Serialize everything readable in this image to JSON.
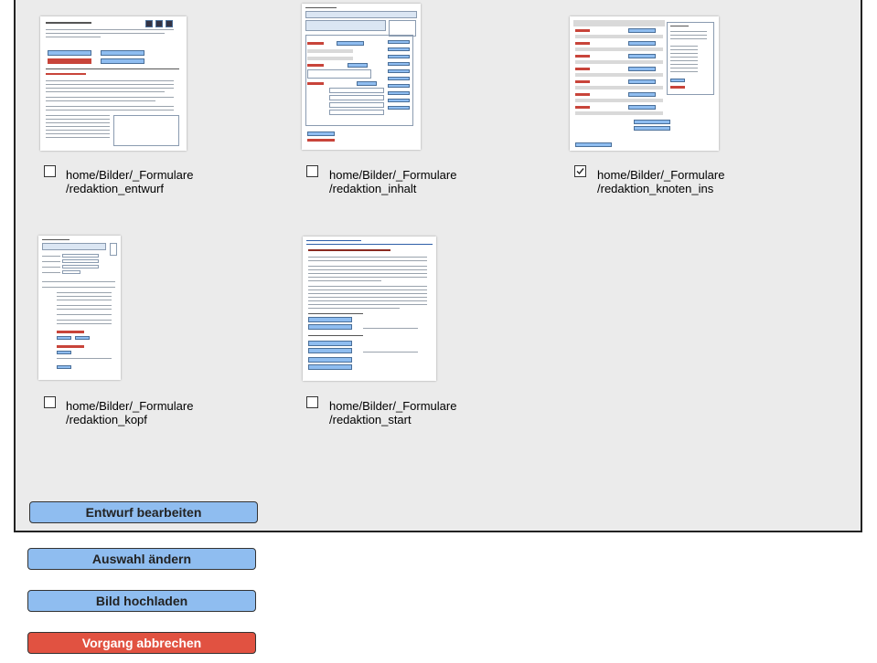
{
  "items": [
    {
      "line1": "home/Bilder/_Formulare",
      "line2": "/redaktion_entwurf",
      "checked": false
    },
    {
      "line1": "home/Bilder/_Formulare",
      "line2": "/redaktion_inhalt",
      "checked": false
    },
    {
      "line1": "home/Bilder/_Formulare",
      "line2": "/redaktion_knoten_ins",
      "checked": true
    },
    {
      "line1": "home/Bilder/_Formulare",
      "line2": "/redaktion_kopf",
      "checked": false
    },
    {
      "line1": "home/Bilder/_Formulare",
      "line2": "/redaktion_start",
      "checked": false
    }
  ],
  "buttons": {
    "edit_draft": "Entwurf bearbeiten",
    "change_selection": "Auswahl ändern",
    "upload_image": "Bild hochladen",
    "cancel": "Vorgang abbrechen"
  },
  "colors": {
    "panel_bg": "#ebebeb",
    "button_blue": "#8fbdf0",
    "button_red": "#e15241"
  }
}
